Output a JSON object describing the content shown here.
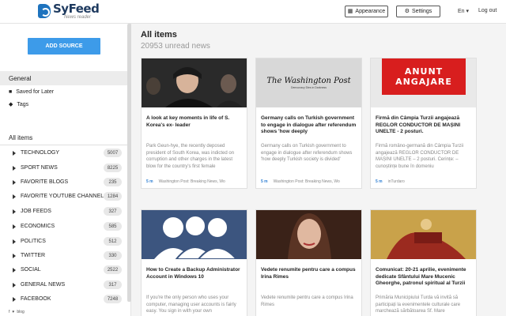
{
  "header": {
    "logo_name": "SyFeed",
    "logo_sub": "News reader",
    "appearance_label": "Appearance",
    "settings_label": "Settings",
    "language": "En",
    "logout_label": "Log out"
  },
  "sidebar": {
    "add_source_label": "ADD SOURCE",
    "general_heading": "General",
    "saved_label": "Saved for Later",
    "tags_label": "Tags",
    "all_items_label": "All items",
    "categories": [
      {
        "label": "TECHNOLOGY",
        "count": "5007"
      },
      {
        "label": "SPORT NEWS",
        "count": "8225"
      },
      {
        "label": "FAVORITE BLOGS",
        "count": "235"
      },
      {
        "label": "FAVORITE YOUTUBE CHANNELS",
        "count": "1284"
      },
      {
        "label": "JOB FEEDS",
        "count": "327"
      },
      {
        "label": "ECONOMICS",
        "count": "585"
      },
      {
        "label": "POLITICS",
        "count": "512"
      },
      {
        "label": "TWITTER",
        "count": "330"
      },
      {
        "label": "SOCIAL",
        "count": "2522"
      },
      {
        "label": "GENERAL NEWS",
        "count": "317"
      },
      {
        "label": "FACEBOOK",
        "count": "7248"
      }
    ],
    "footer_blog": "blog"
  },
  "main": {
    "title": "All items",
    "unread": "20953 unread news",
    "cards": [
      {
        "title": "A look at key moments in life of S. Korea's ex- leader",
        "excerpt": "Park Geun-hye, the recently deposed president of South Korea, was indicted on corruption and other charges in the latest blow for the country's first female",
        "time": "5 m",
        "source": "Washington Post: Breaking News, Wo"
      },
      {
        "title": "Germany calls on Turkish government to engage in dialogue after referendum shows 'how deeply",
        "excerpt": "Germany calls on Turkish government to engage in dialogue after referendum shows 'how deeply Turkish society is divided'",
        "time": "5 m",
        "source": "Washington Post: Breaking News, Wo",
        "image_text": "The Washington Post",
        "image_tagline": "Democracy Dies in Darkness"
      },
      {
        "title": "Firmă din Câmpia Turzii angajează REGLOR CONDUCTOR DE MAȘINI UNELTE - 2 posturi.",
        "excerpt": "Firmă româno-germană din Câmpia Turzii angajează REGLOR CONDUCTOR DE MAȘINI UNELTE – 2 posturi. Cerințe: – cunoștințe bune în domeniu",
        "time": "5 m",
        "source": "inTurdaro",
        "image_text": "ANUNT ANGAJARE"
      },
      {
        "title": "How to Create a Backup Administrator Account in Windows 10",
        "excerpt": "If you're the only person who uses your computer, managing user accounts is fairly easy. You sign in with your own",
        "time": "",
        "source": ""
      },
      {
        "title": "Vedete renumite pentru care a compus Irina Rimes",
        "excerpt": "Vedete renumite pentru care a compus Irina Rimes",
        "time": "",
        "source": ""
      },
      {
        "title": "Comunicat: 20-21 aprilie, evenimente dedicate Sfântului Mare Mucenic Gheorghe, patronul spiritual al Turzii",
        "excerpt": "Primăria Municipiului Turda vă invită să participați la evenimentele culturale care marchează sărbătoarea Sf. Mare",
        "time": "",
        "source": ""
      }
    ]
  }
}
